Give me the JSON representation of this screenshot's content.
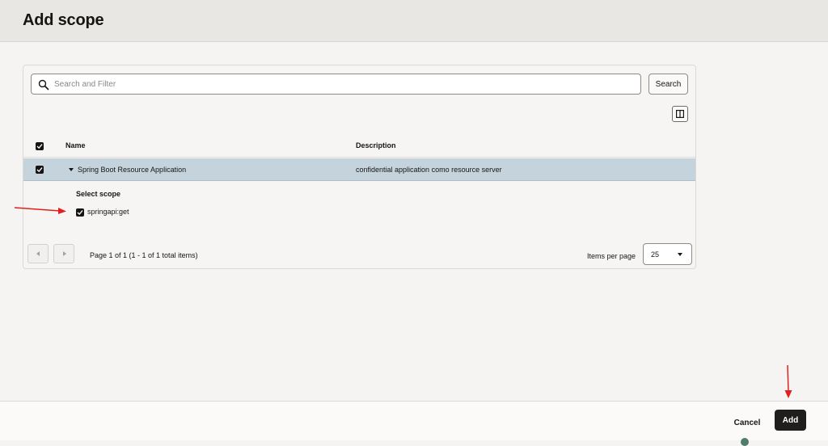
{
  "page": {
    "title": "Add scope"
  },
  "search": {
    "placeholder": "Search and Filter",
    "button_label": "Search"
  },
  "table": {
    "columns": [
      "Name",
      "Description"
    ],
    "rows": [
      {
        "name": "Spring Boot Resource Application",
        "description": "confidential application como resource server",
        "selected": true,
        "expanded": true
      }
    ],
    "expanded": {
      "label": "Select scope",
      "scopes": [
        {
          "name": "springapi:get",
          "checked": true
        }
      ]
    }
  },
  "pagination": {
    "info": "Page 1 of 1 (1 - 1 of 1 total items)",
    "items_per_page_label": "Items per page",
    "items_per_page_value": "25"
  },
  "footer": {
    "cancel_label": "Cancel",
    "add_label": "Add"
  },
  "colors": {
    "selected_row": "#c5d3dd",
    "primary_button": "#1f1e1c",
    "annotation_arrow": "#e02020"
  },
  "icons": [
    "search-icon",
    "columns-icon",
    "checkbox-checked-icon",
    "caret-down-icon",
    "chevron-left-icon",
    "chevron-right-icon",
    "chevron-down-icon"
  ]
}
